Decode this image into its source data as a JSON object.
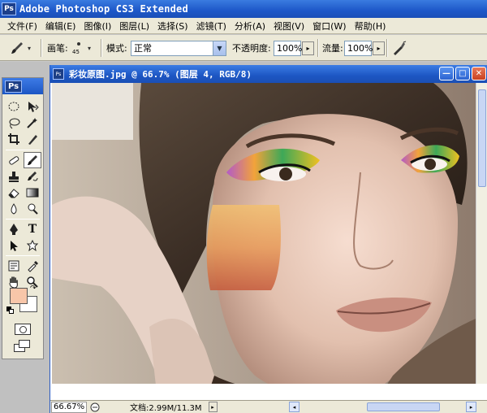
{
  "app": {
    "title": "Adobe Photoshop CS3 Extended",
    "logo": "Ps"
  },
  "menu": [
    {
      "label": "文件(F)"
    },
    {
      "label": "编辑(E)"
    },
    {
      "label": "图像(I)"
    },
    {
      "label": "图层(L)"
    },
    {
      "label": "选择(S)"
    },
    {
      "label": "滤镜(T)"
    },
    {
      "label": "分析(A)"
    },
    {
      "label": "视图(V)"
    },
    {
      "label": "窗口(W)"
    },
    {
      "label": "帮助(H)"
    }
  ],
  "options_bar": {
    "brush_label": "画笔:",
    "brush_size": "45",
    "mode_label": "模式:",
    "mode_value": "正常",
    "opacity_label": "不透明度:",
    "opacity_value": "100%",
    "flow_label": "流量:",
    "flow_value": "100%"
  },
  "toolbox": {
    "logo": "Ps",
    "foreground_color": "#f8c6a9",
    "background_color": "#ffffff"
  },
  "document": {
    "title": "彩妆原图.jpg @ 66.7% (图层 4, RGB/8)",
    "zoom": "66.67%",
    "doc_size": "文档:2.99M/11.3M"
  },
  "colors": {
    "title_bar": "#1d57c8",
    "chrome": "#ece9d8",
    "workspace": "#c0c0c0"
  }
}
